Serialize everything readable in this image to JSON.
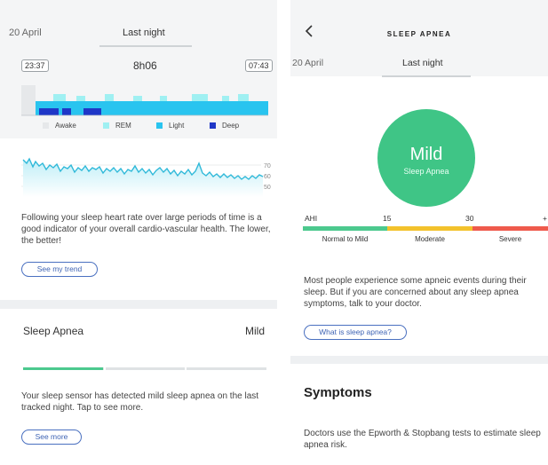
{
  "left": {
    "tabs": [
      {
        "label": "20 April",
        "active": false
      },
      {
        "label": "Last night",
        "active": true
      }
    ],
    "summary": {
      "start_time": "23:37",
      "duration": "8h06",
      "end_time": "07:43"
    },
    "legend": [
      {
        "label": "Awake",
        "color": "#e6e8ea"
      },
      {
        "label": "REM",
        "color": "#9ff0f2"
      },
      {
        "label": "Light",
        "color": "#29c4ef"
      },
      {
        "label": "Deep",
        "color": "#1f37c7"
      }
    ],
    "heart_rate_ticks": [
      "70",
      "60",
      "50"
    ],
    "heart_rate_text": "Following your sleep heart rate over large periods of time is a good indicator of your overall cardio-vascular health. The lower, the better!",
    "trend_button": "See my trend",
    "sleep_apnea": {
      "title": "Sleep Apnea",
      "value": "Mild",
      "severity_fraction": 0.33,
      "text": "Your sleep sensor has detected mild sleep apnea on the last tracked night. Tap to see more.",
      "more_button": "See more"
    }
  },
  "right": {
    "title": "SLEEP APNEA",
    "back_icon": "chevron-left-icon",
    "tabs": [
      {
        "label": "20 April",
        "active": false
      },
      {
        "label": "Last night",
        "active": true
      }
    ],
    "result": {
      "level": "Mild",
      "caption": "Sleep Apnea",
      "color": "#3fc586"
    },
    "scale": {
      "numbers": [
        "AHI",
        "15",
        "30",
        "+"
      ],
      "segments": [
        {
          "label": "Normal to Mild",
          "color": "#4cc98e"
        },
        {
          "label": "Moderate",
          "color": "#f3c22c"
        },
        {
          "label": "Severe",
          "color": "#ef5a4c"
        }
      ]
    },
    "info_text": "Most people experience some apneic events during their sleep. But if you are concerned about any sleep apnea symptoms, talk to your doctor.",
    "info_button": "What is sleep apnea?",
    "symptoms": {
      "title": "Symptoms",
      "text": "Doctors use the Epworth & Stopbang tests to estimate sleep apnea risk."
    }
  }
}
